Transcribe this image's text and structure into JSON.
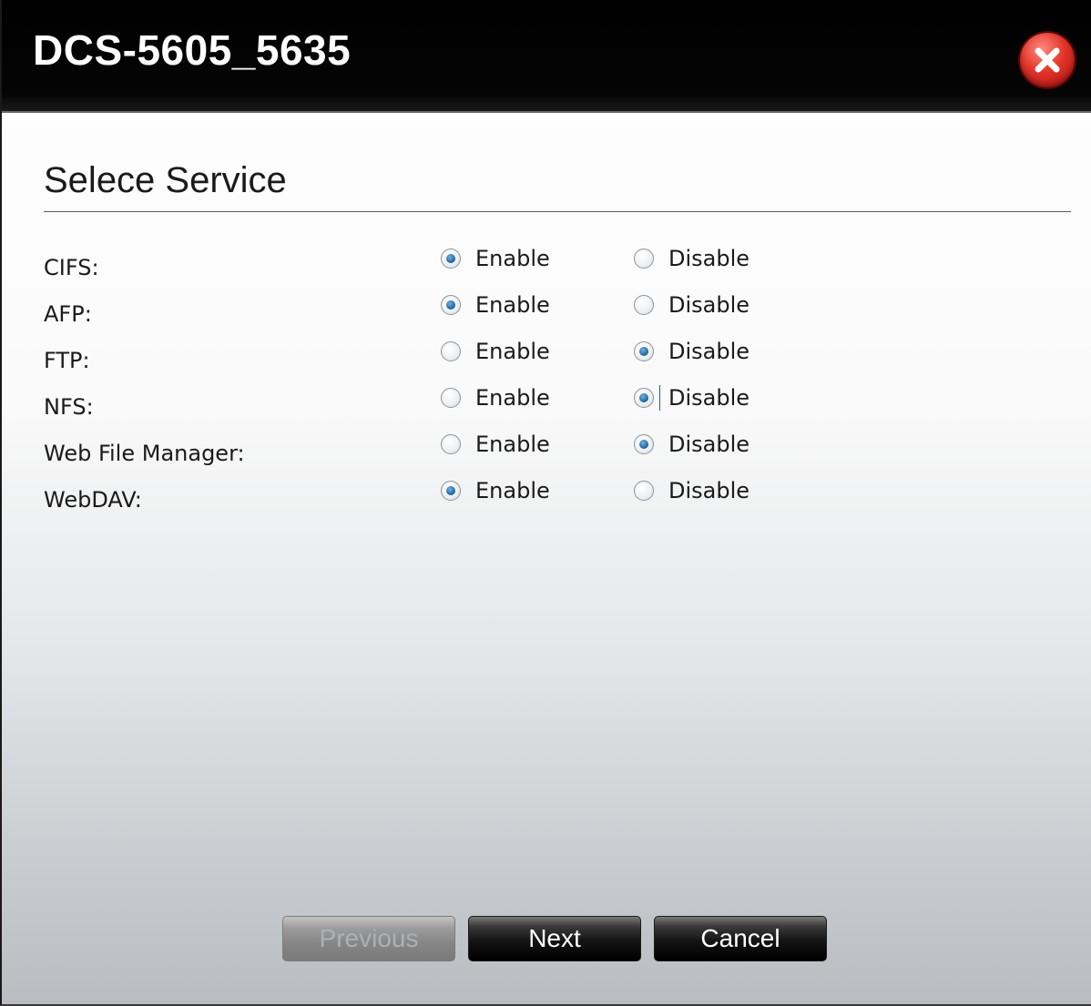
{
  "window": {
    "title": "DCS-5605_5635"
  },
  "section": {
    "title": "Selece Service"
  },
  "options": {
    "enable_label": "Enable",
    "disable_label": "Disable"
  },
  "services": [
    {
      "label": "CIFS:",
      "selected": "enable"
    },
    {
      "label": "AFP:",
      "selected": "enable"
    },
    {
      "label": "FTP:",
      "selected": "disable"
    },
    {
      "label": "NFS:",
      "selected": "disable"
    },
    {
      "label": "Web File Manager:",
      "selected": "disable"
    },
    {
      "label": "WebDAV:",
      "selected": "enable"
    }
  ],
  "buttons": {
    "previous": "Previous",
    "next": "Next",
    "cancel": "Cancel"
  },
  "icons": {
    "close": "close-icon"
  },
  "colors": {
    "titlebar": "#000000",
    "close_button": "#e2342a",
    "radio_selected": "#1d5f97"
  }
}
